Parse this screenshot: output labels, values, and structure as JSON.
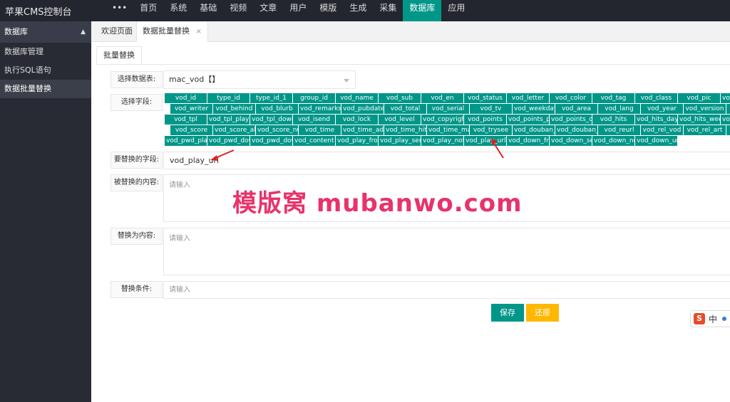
{
  "brand": "苹果CMS控制台",
  "topnav": [
    "•••",
    "首页",
    "系统",
    "基础",
    "视频",
    "文章",
    "用户",
    "模版",
    "生成",
    "采集",
    "数据库",
    "应用"
  ],
  "topnav_active": 10,
  "sidebar": {
    "head": "数据库",
    "items": [
      "数据库管理",
      "执行SQL语句",
      "数据批量替换"
    ],
    "active": 2
  },
  "tabs": {
    "welcome": "欢迎页面",
    "current": "数据批量替换",
    "close": "×"
  },
  "subtab": "批量替换",
  "form": {
    "table_label": "选择数据表:",
    "table_value": "mac_vod【】",
    "fields_label": "选择字段:",
    "fields": [
      [
        "vod_id",
        "type_id",
        "type_id_1",
        "group_id",
        "vod_name",
        "vod_sub",
        "vod_en",
        "vod_status",
        "vod_letter",
        "vod_color",
        "vod_tag",
        "vod_class",
        "vod_pic",
        "vod_pic_thumb"
      ],
      [
        "vod_writer",
        "vod_behind",
        "vod_blurb",
        "vod_remarks",
        "vod_pubdate",
        "vod_total",
        "vod_serial",
        "vod_tv",
        "vod_weekday",
        "vod_area",
        "vod_lang",
        "vod_year",
        "vod_version",
        "vod_state"
      ],
      [
        "vod_tpl",
        "vod_tpl_play",
        "vod_tpl_down",
        "vod_isend",
        "vod_lock",
        "vod_level",
        "vod_copyright",
        "vod_points",
        "vod_points_play",
        "vod_points_down",
        "vod_hits",
        "vod_hits_day",
        "vod_hits_week",
        "vod_hits_month"
      ],
      [
        "vod_score",
        "vod_score_all",
        "vod_score_num",
        "vod_time",
        "vod_time_add",
        "vod_time_hits",
        "vod_time_make",
        "vod_trysee",
        "vod_douban_id",
        "vod_douban_score",
        "vod_reurl",
        "vod_rel_vod",
        "vod_rel_art",
        "vod_pwd"
      ],
      [
        "vod_pwd_play",
        "vod_pwd_down",
        "vod_pwd_down_url",
        "vod_content",
        "vod_play_from",
        "vod_play_server",
        "vod_play_note",
        "vod_play_url",
        "vod_down_from",
        "vod_down_server",
        "vod_down_note",
        "vod_down_url"
      ]
    ],
    "replace_field_label": "要替换的字段:",
    "replace_field_value": "vod_play_url",
    "replaced_label": "被替换的内容:",
    "replaced_placeholder": "请输入",
    "replace_with_label": "替换为内容:",
    "replace_with_placeholder": "请输入",
    "condition_label": "替换条件:",
    "condition_placeholder": "请输入",
    "save": "保存",
    "reset": "还原"
  },
  "watermark": "模版窝 mubanwo.com",
  "ime": {
    "logo": "S",
    "lang": "中"
  },
  "colors": {
    "primary": "#009688",
    "warn": "#ffb800",
    "topbar": "#23262e",
    "sidebar": "#282b33",
    "watermark": "#e8336a"
  }
}
